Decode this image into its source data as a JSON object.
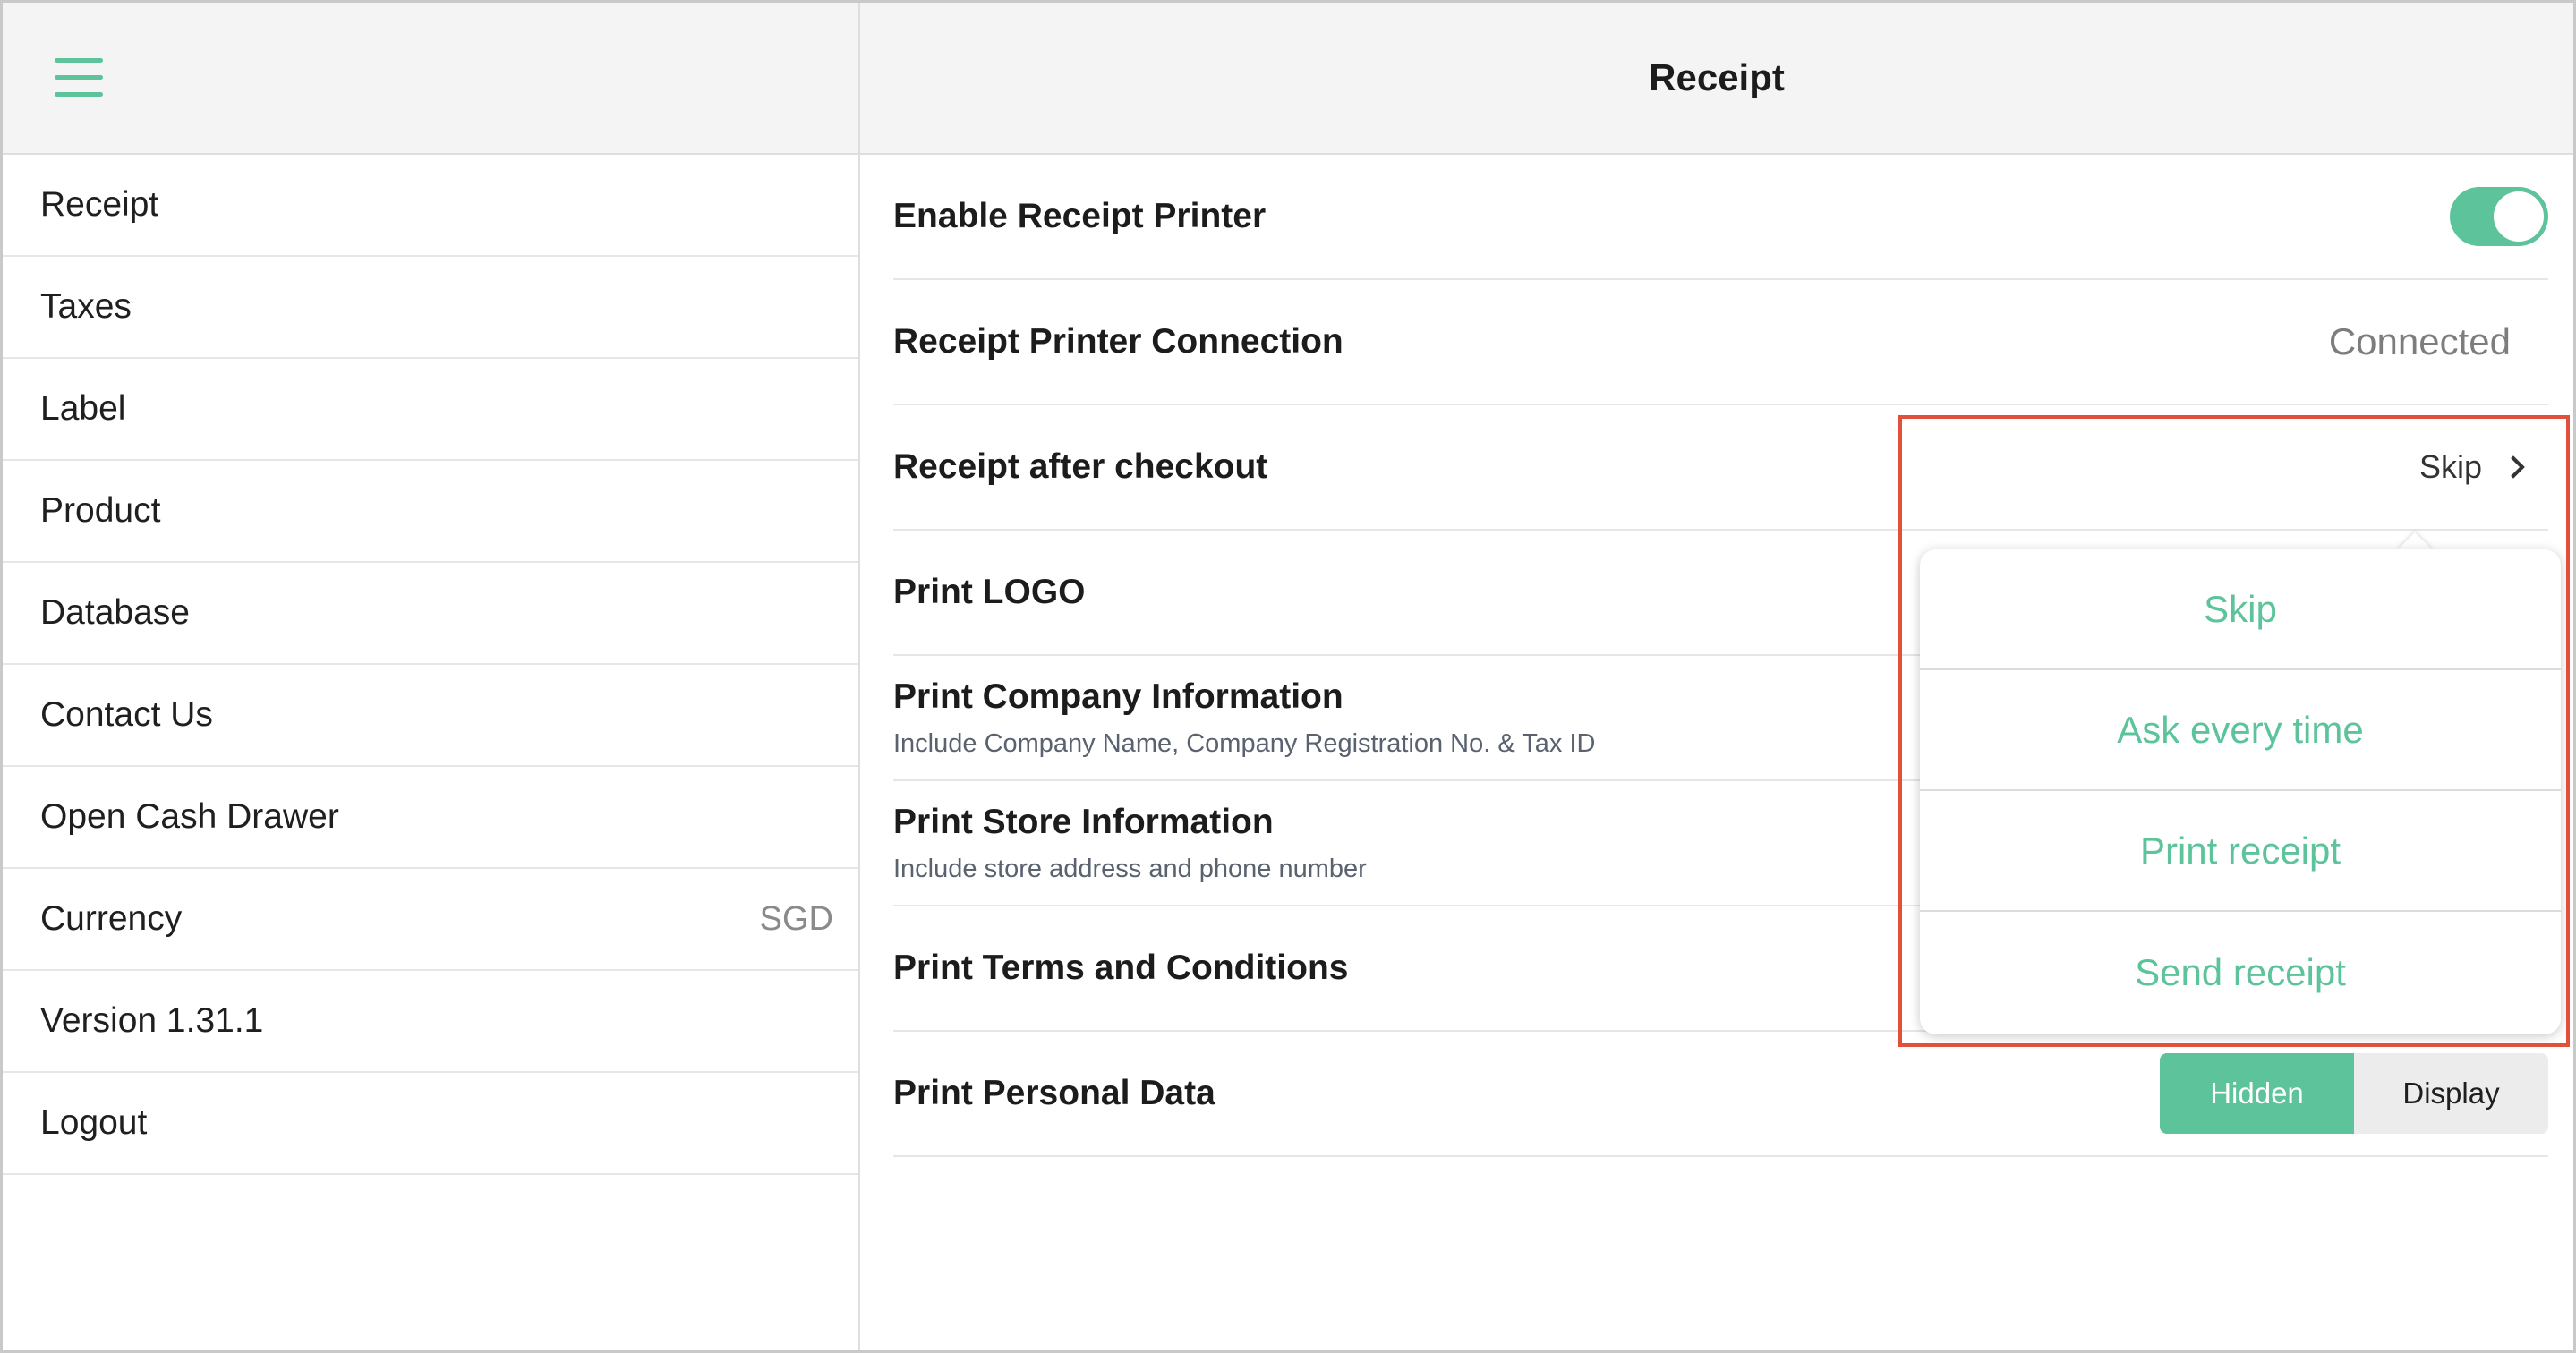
{
  "sidebar": {
    "items": [
      {
        "label": "Receipt",
        "value": ""
      },
      {
        "label": "Taxes",
        "value": ""
      },
      {
        "label": "Label",
        "value": ""
      },
      {
        "label": "Product",
        "value": ""
      },
      {
        "label": "Database",
        "value": ""
      },
      {
        "label": "Contact Us",
        "value": ""
      },
      {
        "label": "Open Cash Drawer",
        "value": ""
      },
      {
        "label": "Currency",
        "value": "SGD"
      },
      {
        "label": "Version 1.31.1",
        "value": ""
      },
      {
        "label": "Logout",
        "value": ""
      }
    ]
  },
  "header": {
    "title": "Receipt"
  },
  "settings": {
    "enable_printer": {
      "label": "Enable Receipt Printer",
      "on": true
    },
    "connection": {
      "label": "Receipt Printer Connection",
      "value": "Connected"
    },
    "after_checkout": {
      "label": "Receipt after checkout",
      "value": "Skip"
    },
    "print_logo": {
      "label": "Print LOGO"
    },
    "company_info": {
      "label": "Print Company Information",
      "sub": "Include Company Name, Company Registration No. & Tax ID"
    },
    "store_info": {
      "label": "Print Store Information",
      "sub": "Include store address and phone number"
    },
    "terms": {
      "label": "Print Terms and Conditions"
    },
    "personal_data": {
      "label": "Print Personal Data",
      "options": [
        "Hidden",
        "Display"
      ],
      "selected": "Hidden"
    }
  },
  "popover": {
    "options": [
      "Skip",
      "Ask every time",
      "Print receipt",
      "Send receipt"
    ]
  },
  "colors": {
    "accent": "#5cc39a",
    "highlight": "#e0503a"
  },
  "icons": {
    "menu": "hamburger-menu-icon",
    "chevron": "chevron-right-icon"
  }
}
